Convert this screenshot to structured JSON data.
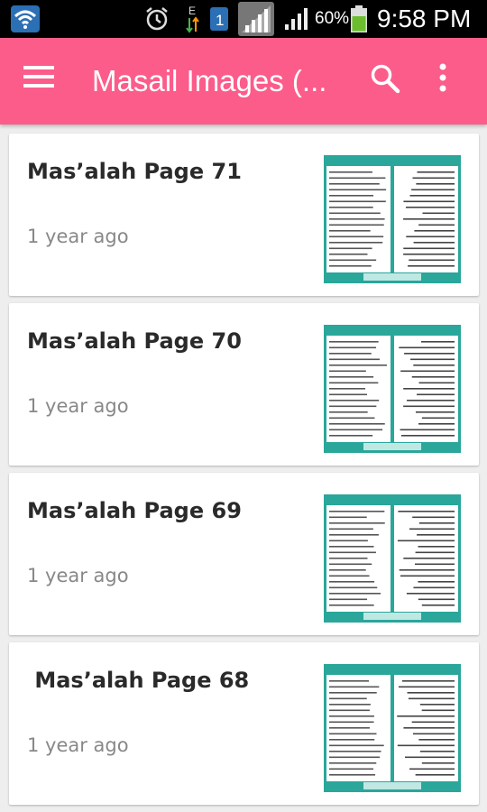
{
  "status_bar": {
    "battery_percent": "60%",
    "time": "9:58 PM",
    "data_indicator": "E",
    "sim_slot": "1",
    "icons": [
      "wifi-icon",
      "alarm-clock-icon",
      "data-transfer-icon",
      "sim-icon",
      "signal-strength-icon",
      "signal-strength-icon",
      "battery-icon"
    ]
  },
  "app_bar": {
    "title": "Masail Images (...",
    "menu_icon": "hamburger-menu-icon",
    "search_icon": "search-icon",
    "more_icon": "more-vert-icon",
    "color": "#fc5c8a"
  },
  "items": [
    {
      "title": "Mas’alah Page 71",
      "time": "1 year ago"
    },
    {
      "title": "Mas’alah Page 70",
      "time": "1 year ago"
    },
    {
      "title": "Mas’alah Page 69",
      "time": "1 year ago"
    },
    {
      "title": " Mas’alah Page 68",
      "time": "1 year ago"
    }
  ],
  "colors": {
    "background": "#eeeeee",
    "card": "#ffffff",
    "thumbnail_frame": "#2aa69a",
    "title_text": "#2a2a2a",
    "time_text": "#888888"
  }
}
